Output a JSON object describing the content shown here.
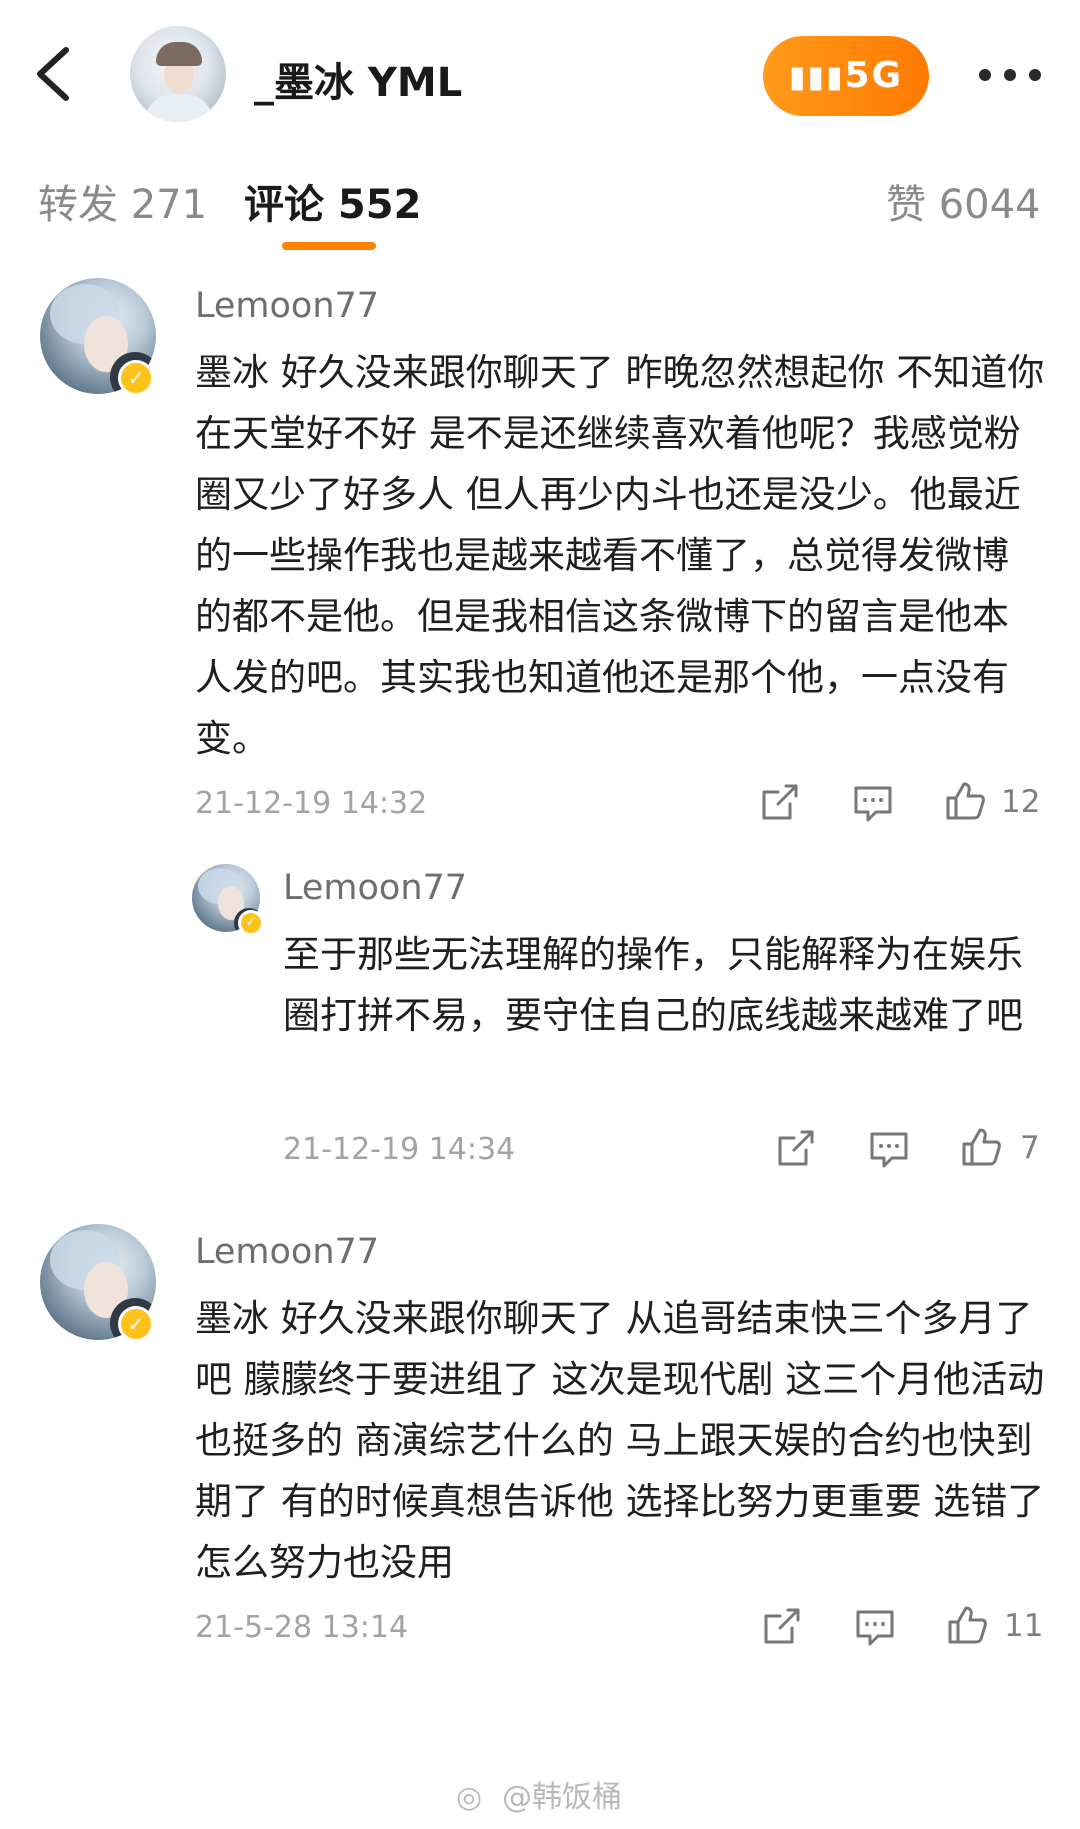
{
  "header": {
    "title": "_墨冰 YML",
    "network_badge": "5G",
    "more_icon": "more-dots-icon",
    "back_icon": "chevron-left-icon"
  },
  "tabs": {
    "repost": "转发 271",
    "comments": "评论 552",
    "likes": "赞 6044",
    "accent_color": "#ff8200"
  },
  "comments": [
    {
      "username": "Lemoon77",
      "text": "墨冰 好久没来跟你聊天了 昨晚忽然想起你 不知道你在天堂好不好 是不是还继续喜欢着他呢？我感觉粉圈又少了好多人 但人再少内斗也还是没少。他最近的一些操作我也是越来越看不懂了，总觉得发微博的都不是他。但是我相信这条微博下的留言是他本人发的吧。其实我也知道他还是那个他，一点没有变。",
      "time": "21-12-19 14:32",
      "likes": "12"
    },
    {
      "username": "Lemoon77",
      "text": "至于那些无法理解的操作，只能解释为在娱乐圈打拼不易，要守住自己的底线越来越难了吧",
      "time": "21-12-19 14:34",
      "likes": "7"
    },
    {
      "username": "Lemoon77",
      "text": "墨冰 好久没来跟你聊天了 从追哥结束快三个多月了吧 朦朦终于要进组了 这次是现代剧 这三个月他活动也挺多的 商演综艺什么的 马上跟天娱的合约也快到期了 有的时候真想告诉他 选择比努力更重要 选错了怎么努力也没用",
      "time": "21-5-28 13:14",
      "likes": "11"
    }
  ],
  "watermark": "@韩饭桶"
}
